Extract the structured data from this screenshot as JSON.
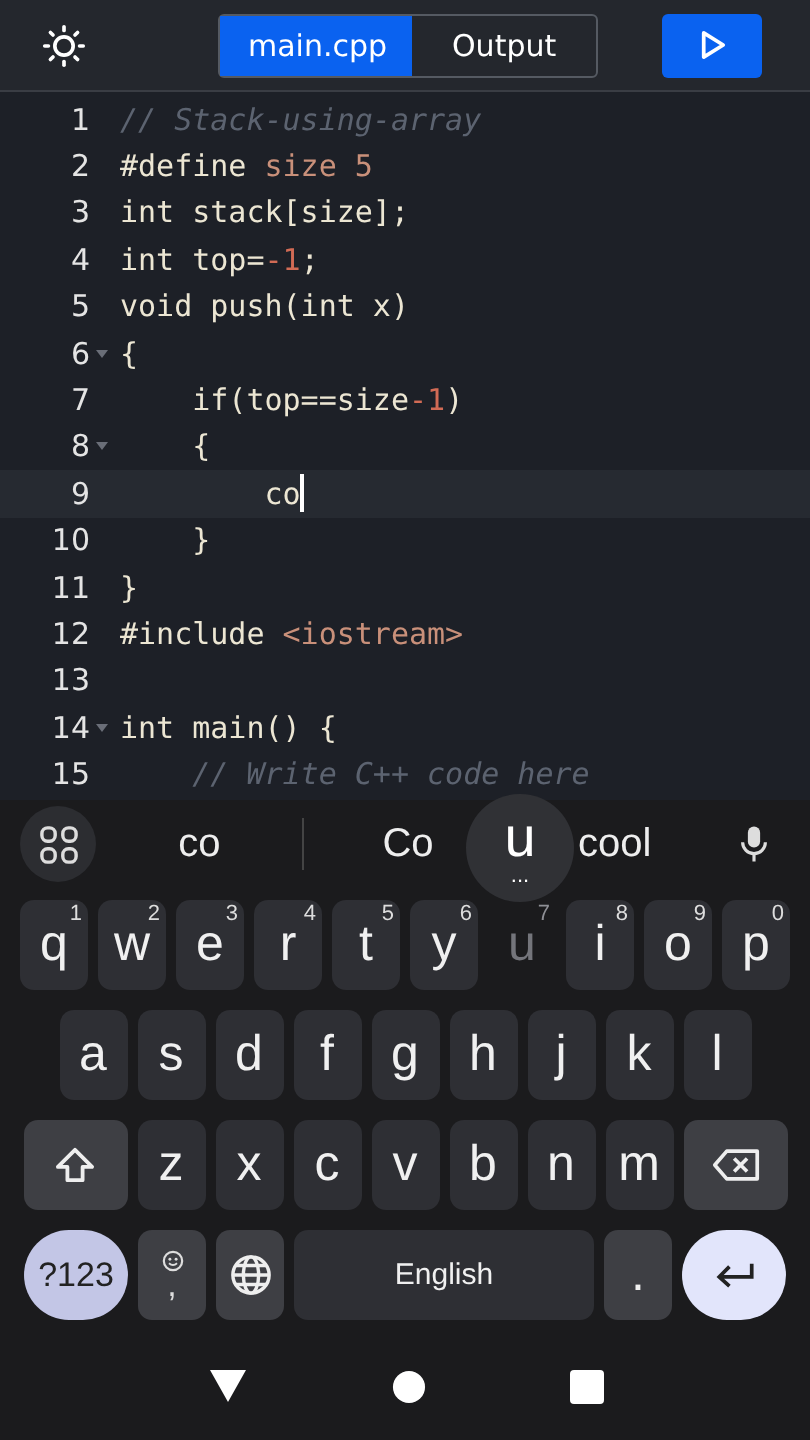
{
  "toolbar": {
    "tabs": [
      {
        "label": "main.cpp",
        "selected": true
      },
      {
        "label": "Output",
        "selected": false
      }
    ]
  },
  "editor": {
    "lines": [
      {
        "number": "1",
        "fold": false,
        "current": false,
        "tokens": [
          {
            "text": "// Stack-using-array",
            "kind": "comment"
          }
        ]
      },
      {
        "number": "2",
        "fold": false,
        "current": false,
        "tokens": [
          {
            "text": "#define ",
            "kind": "plain"
          },
          {
            "text": "size 5",
            "kind": "literal"
          }
        ]
      },
      {
        "number": "3",
        "fold": false,
        "current": false,
        "tokens": [
          {
            "text": "int stack[size];",
            "kind": "plain"
          }
        ]
      },
      {
        "number": "4",
        "fold": false,
        "current": false,
        "tokens": [
          {
            "text": "int top=",
            "kind": "plain"
          },
          {
            "text": "-1",
            "kind": "number"
          },
          {
            "text": ";",
            "kind": "plain"
          }
        ]
      },
      {
        "number": "5",
        "fold": false,
        "current": false,
        "tokens": [
          {
            "text": "void push(int x)",
            "kind": "plain"
          }
        ]
      },
      {
        "number": "6",
        "fold": true,
        "current": false,
        "tokens": [
          {
            "text": "{",
            "kind": "plain"
          }
        ]
      },
      {
        "number": "7",
        "fold": false,
        "current": false,
        "tokens": [
          {
            "text": "    if(top==size",
            "kind": "plain"
          },
          {
            "text": "-1",
            "kind": "number"
          },
          {
            "text": ")",
            "kind": "plain"
          }
        ]
      },
      {
        "number": "8",
        "fold": true,
        "current": false,
        "tokens": [
          {
            "text": "    {",
            "kind": "plain"
          }
        ]
      },
      {
        "number": "9",
        "fold": false,
        "current": true,
        "tokens": [
          {
            "text": "        co",
            "kind": "plain"
          }
        ]
      },
      {
        "number": "10",
        "fold": false,
        "current": false,
        "tokens": [
          {
            "text": "    }",
            "kind": "plain"
          }
        ]
      },
      {
        "number": "11",
        "fold": false,
        "current": false,
        "tokens": [
          {
            "text": "}",
            "kind": "plain"
          }
        ]
      },
      {
        "number": "12",
        "fold": false,
        "current": false,
        "tokens": [
          {
            "text": "#include ",
            "kind": "plain"
          },
          {
            "text": "<iostream>",
            "kind": "literal"
          }
        ]
      },
      {
        "number": "13",
        "fold": false,
        "current": false
      },
      {
        "number": "14",
        "fold": true,
        "current": false,
        "tokens": [
          {
            "text": "int main() {",
            "kind": "plain"
          }
        ]
      },
      {
        "number": "15",
        "fold": false,
        "current": false,
        "tokens": [
          {
            "text": "    // Write C++ code here",
            "kind": "comment"
          }
        ]
      }
    ]
  },
  "keyboard": {
    "suggestions": [
      "co",
      "Co",
      "cool"
    ],
    "key_popup": {
      "label": "u",
      "more": "..."
    },
    "rows": [
      {
        "keys": [
          {
            "label": "q",
            "hint": "1",
            "kind": "letter",
            "pressed": false
          },
          {
            "label": "w",
            "hint": "2",
            "kind": "letter",
            "pressed": false
          },
          {
            "label": "e",
            "hint": "3",
            "kind": "letter",
            "pressed": false
          },
          {
            "label": "r",
            "hint": "4",
            "kind": "letter",
            "pressed": false
          },
          {
            "label": "t",
            "hint": "5",
            "kind": "letter",
            "pressed": false
          },
          {
            "label": "y",
            "hint": "6",
            "kind": "letter",
            "pressed": false
          },
          {
            "label": "u",
            "hint": "7",
            "kind": "letter",
            "pressed": true
          },
          {
            "label": "i",
            "hint": "8",
            "kind": "letter",
            "pressed": false
          },
          {
            "label": "o",
            "hint": "9",
            "kind": "letter",
            "pressed": false
          },
          {
            "label": "p",
            "hint": "0",
            "kind": "letter",
            "pressed": false
          }
        ]
      },
      {
        "keys": [
          {
            "label": "a",
            "kind": "letter",
            "pressed": false
          },
          {
            "label": "s",
            "kind": "letter",
            "pressed": false
          },
          {
            "label": "d",
            "kind": "letter",
            "pressed": false
          },
          {
            "label": "f",
            "kind": "letter",
            "pressed": false
          },
          {
            "label": "g",
            "kind": "letter",
            "pressed": false
          },
          {
            "label": "h",
            "kind": "letter",
            "pressed": false
          },
          {
            "label": "j",
            "kind": "letter",
            "pressed": false
          },
          {
            "label": "k",
            "kind": "letter",
            "pressed": false
          },
          {
            "label": "l",
            "kind": "letter",
            "pressed": false
          }
        ]
      },
      {
        "keys": [
          {
            "kind": "shift",
            "pressed": false
          },
          {
            "label": "z",
            "kind": "letter",
            "pressed": false
          },
          {
            "label": "x",
            "kind": "letter",
            "pressed": false
          },
          {
            "label": "c",
            "kind": "letter",
            "pressed": false
          },
          {
            "label": "v",
            "kind": "letter",
            "pressed": false
          },
          {
            "label": "b",
            "kind": "letter",
            "pressed": false
          },
          {
            "label": "n",
            "kind": "letter",
            "pressed": false
          },
          {
            "label": "m",
            "kind": "letter",
            "pressed": false
          },
          {
            "kind": "backspace",
            "pressed": false
          }
        ]
      },
      {
        "keys": [
          {
            "label": "?123",
            "kind": "symbols",
            "pressed": false
          },
          {
            "label": ",",
            "kind": "emoji",
            "pressed": false
          },
          {
            "kind": "globe",
            "pressed": false
          },
          {
            "label": "English",
            "kind": "space",
            "pressed": false
          },
          {
            "label": ".",
            "kind": "period",
            "pressed": false
          },
          {
            "kind": "enter",
            "pressed": false
          }
        ]
      }
    ]
  }
}
